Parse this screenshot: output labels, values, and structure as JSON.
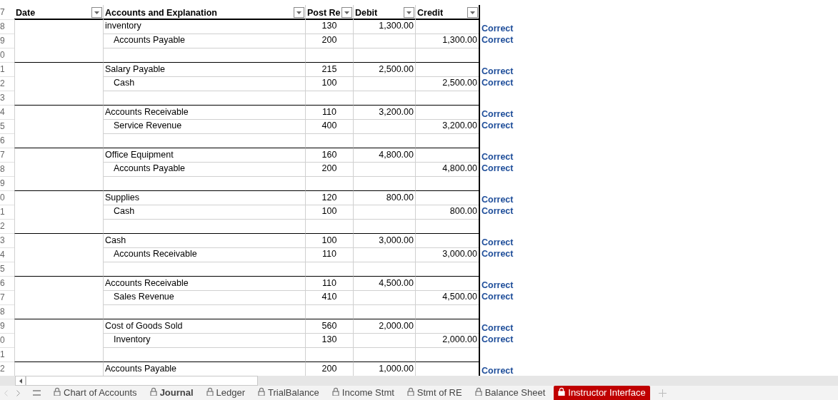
{
  "header": {
    "row_label": "7",
    "columns": [
      {
        "label": "Date"
      },
      {
        "label": "Accounts and Explanation"
      },
      {
        "label": "Post Re"
      },
      {
        "label": "Debit"
      },
      {
        "label": "Credit"
      }
    ]
  },
  "rows": [
    {
      "row_label": "8",
      "kind": "debit",
      "account": "inventory",
      "post_ref": "130",
      "debit": "1,300.00",
      "credit": "",
      "check": "Correct"
    },
    {
      "row_label": "9",
      "kind": "credit",
      "account": "Accounts Payable",
      "post_ref": "200",
      "debit": "",
      "credit": "1,300.00",
      "check": "Correct"
    },
    {
      "row_label": "0",
      "kind": "blank"
    },
    {
      "row_label": "1",
      "kind": "debit",
      "account": "Salary Payable",
      "post_ref": "215",
      "debit": "2,500.00",
      "credit": "",
      "check": "Correct"
    },
    {
      "row_label": "2",
      "kind": "credit",
      "account": "Cash",
      "post_ref": "100",
      "debit": "",
      "credit": "2,500.00",
      "check": "Correct"
    },
    {
      "row_label": "3",
      "kind": "blank"
    },
    {
      "row_label": "4",
      "kind": "debit",
      "account": "Accounts Receivable",
      "post_ref": "110",
      "debit": "3,200.00",
      "credit": "",
      "check": "Correct"
    },
    {
      "row_label": "5",
      "kind": "credit",
      "account": "Service Revenue",
      "post_ref": "400",
      "debit": "",
      "credit": "3,200.00",
      "check": "Correct"
    },
    {
      "row_label": "6",
      "kind": "blank"
    },
    {
      "row_label": "7",
      "kind": "debit",
      "account": "Office Equipment",
      "post_ref": "160",
      "debit": "4,800.00",
      "credit": "",
      "check": "Correct"
    },
    {
      "row_label": "8",
      "kind": "credit",
      "account": "Accounts Payable",
      "post_ref": "200",
      "debit": "",
      "credit": "4,800.00",
      "check": "Correct"
    },
    {
      "row_label": "9",
      "kind": "blank"
    },
    {
      "row_label": "0",
      "kind": "debit",
      "account": "Supplies",
      "post_ref": "120",
      "debit": "800.00",
      "credit": "",
      "check": "Correct"
    },
    {
      "row_label": "1",
      "kind": "credit",
      "account": "Cash",
      "post_ref": "100",
      "debit": "",
      "credit": "800.00",
      "check": "Correct"
    },
    {
      "row_label": "2",
      "kind": "blank"
    },
    {
      "row_label": "3",
      "kind": "debit",
      "account": "Cash",
      "post_ref": "100",
      "debit": "3,000.00",
      "credit": "",
      "check": "Correct"
    },
    {
      "row_label": "4",
      "kind": "credit",
      "account": "Accounts Receivable",
      "post_ref": "110",
      "debit": "",
      "credit": "3,000.00",
      "check": "Correct"
    },
    {
      "row_label": "5",
      "kind": "blank"
    },
    {
      "row_label": "6",
      "kind": "debit",
      "account": "Accounts Receivable",
      "post_ref": "110",
      "debit": "4,500.00",
      "credit": "",
      "check": "Correct"
    },
    {
      "row_label": "7",
      "kind": "credit",
      "account": "Sales Revenue",
      "post_ref": "410",
      "debit": "",
      "credit": "4,500.00",
      "check": "Correct"
    },
    {
      "row_label": "8",
      "kind": "blank"
    },
    {
      "row_label": "9",
      "kind": "debit",
      "account": "Cost of Goods Sold",
      "post_ref": "560",
      "debit": "2,000.00",
      "credit": "",
      "check": "Correct"
    },
    {
      "row_label": "0",
      "kind": "credit",
      "account": "Inventory",
      "post_ref": "130",
      "debit": "",
      "credit": "2,000.00",
      "check": "Correct"
    },
    {
      "row_label": "1",
      "kind": "blank"
    },
    {
      "row_label": "2",
      "kind": "debit",
      "account": "Accounts Payable",
      "post_ref": "200",
      "debit": "1,000.00",
      "credit": "",
      "check": "Correct"
    }
  ],
  "sheet_tabs": [
    {
      "label": "Chart of Accounts",
      "selected": false
    },
    {
      "label": "Journal",
      "selected": true
    },
    {
      "label": "Ledger",
      "selected": false
    },
    {
      "label": "TrialBalance",
      "selected": false
    },
    {
      "label": "Income Stmt",
      "selected": false
    },
    {
      "label": "Stmt of RE",
      "selected": false
    },
    {
      "label": "Balance Sheet",
      "selected": false
    },
    {
      "label": "Instructor Interface",
      "selected": false,
      "color": "#c00000"
    }
  ]
}
